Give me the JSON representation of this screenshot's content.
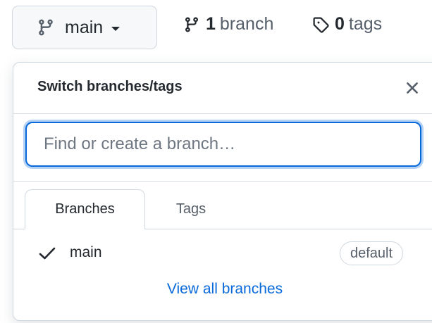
{
  "repo_bar": {
    "current_branch": "main",
    "branch_count": "1",
    "branch_label": "branch",
    "tag_count": "0",
    "tag_label": "tags"
  },
  "popover": {
    "title": "Switch branches/tags",
    "filter_placeholder": "Find or create a branch…",
    "tabs": [
      {
        "label": "Branches",
        "active": true
      },
      {
        "label": "Tags",
        "active": false
      }
    ],
    "branches": [
      {
        "name": "main",
        "badge": "default",
        "selected": true
      }
    ],
    "view_all_label": "View all branches"
  },
  "icons": {
    "branch": "git-branch-icon",
    "tag": "tag-icon",
    "close": "close-icon",
    "check": "check-icon",
    "caret": "triangle-down-icon"
  },
  "colors": {
    "accent": "#0969da",
    "text": "#24292f",
    "muted": "#57606a",
    "border": "#d0d7de"
  }
}
